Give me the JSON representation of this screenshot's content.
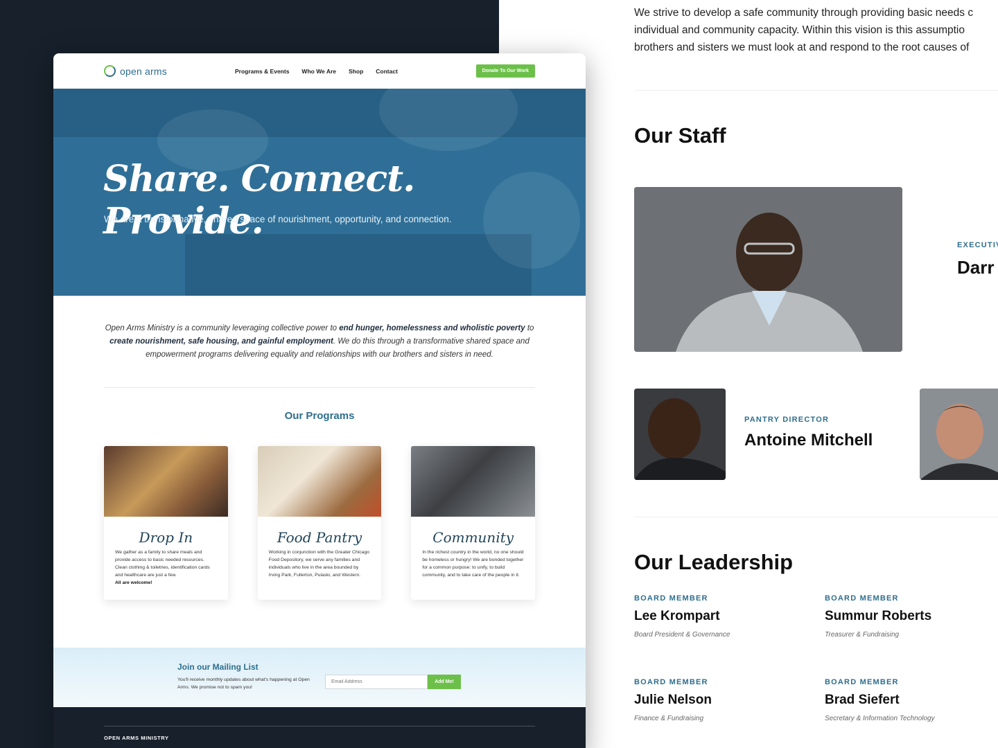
{
  "site": {
    "logo_text": "open arms",
    "nav": [
      "Programs & Events",
      "Who We Are",
      "Shop",
      "Contact"
    ],
    "donate_label": "Donate To Our Work"
  },
  "hero": {
    "title": "Share. Connect. Provide.",
    "subtitle": "We are a transformative, shared space of nourishment, opportunity, and connection."
  },
  "intro": {
    "p1": "Open Arms Ministry is a community leveraging collective power to ",
    "b1": "end hunger, homelessness and wholistic poverty",
    "p2": " to ",
    "b2": "create nourishment, safe housing, and gainful employment",
    "p3": ". We do this through a transformative shared space and empowerment programs delivering equality and relationships with our brothers and sisters in need."
  },
  "programs": {
    "title": "Our Programs",
    "items": [
      {
        "name": "Drop In",
        "text": "We gather as a family to share meals and provide access to basic needed resources. Clean clothing & toiletries, identification cards and healthcare are just a few.",
        "bold": "All are welcome!"
      },
      {
        "name": "Food Pantry",
        "text": "Working in conjunction with the Greater Chicago Food Depository, we serve any families and individuals who live in the area bounded by Irving Park, Fullerton, Pulaski, and Western.",
        "bold": ""
      },
      {
        "name": "Community",
        "text": "In the richest country in the world, no one should be homeless or hungry! We are bonded together for a common purpose: to unify, to build community, and to take care of the people in it.",
        "bold": ""
      }
    ]
  },
  "mailing": {
    "title": "Join our Mailing List",
    "text": "You'll receive monthly updates about what's happening at Open Arms. We promise not to spam you!",
    "placeholder": "Email Address",
    "button": "Add Me!"
  },
  "footer": {
    "title": "OPEN ARMS MINISTRY"
  },
  "about": {
    "mission": [
      "We strive to develop a safe community through providing basic needs c",
      "individual and community capacity. Within this vision is this assumptio",
      "brothers and sisters we must look at and respond to the root causes of"
    ],
    "staff_title": "Our Staff",
    "exec_role": "EXECUTIV",
    "exec_name": "Darr",
    "pantry_role": "PANTRY DIRECTOR",
    "pantry_name": "Antoine Mitchell",
    "leadership_title": "Our Leadership",
    "leaders": [
      {
        "role": "BOARD MEMBER",
        "name": "Lee Krompart",
        "desc": "Board President & Governance"
      },
      {
        "role": "BOARD MEMBER",
        "name": "Summur Roberts",
        "desc": "Treasurer & Fundraising"
      },
      {
        "role": "BOARD MEMBER",
        "name": "Julie Nelson",
        "desc": "Finance & Fundraising"
      },
      {
        "role": "BOARD MEMBER",
        "name": "Brad Siefert",
        "desc": "Secretary & Information Technology"
      }
    ]
  },
  "colors": {
    "brand_green": "#6cc04a",
    "brand_blue": "#2e6e8e",
    "dark_navy": "#17202b"
  }
}
